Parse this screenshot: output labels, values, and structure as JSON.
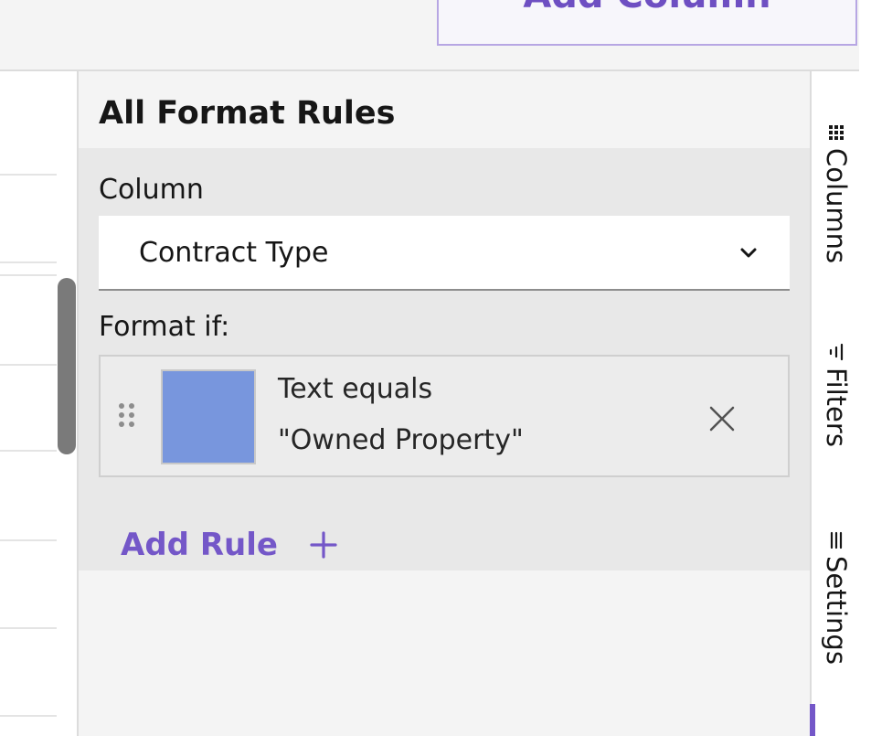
{
  "toolbar": {
    "add_column_label": "Add Column"
  },
  "panel": {
    "title": "All Format Rules",
    "column_label": "Column",
    "column_value": "Contract Type",
    "format_if_label": "Format if:",
    "rules": [
      {
        "condition": "Text equals",
        "value": "\"Owned Property\"",
        "color": "#7896dd"
      }
    ],
    "add_rule_label": "Add Rule"
  },
  "side_tabs": [
    {
      "label": "Columns",
      "icon": "grid-icon"
    },
    {
      "label": "Filters",
      "icon": "filter-icon"
    },
    {
      "label": "Settings",
      "icon": "settings-lines-icon"
    }
  ],
  "colors": {
    "accent": "#7457c8",
    "panel_bg": "#f4f4f4",
    "section_bg": "#e8e8e8"
  }
}
